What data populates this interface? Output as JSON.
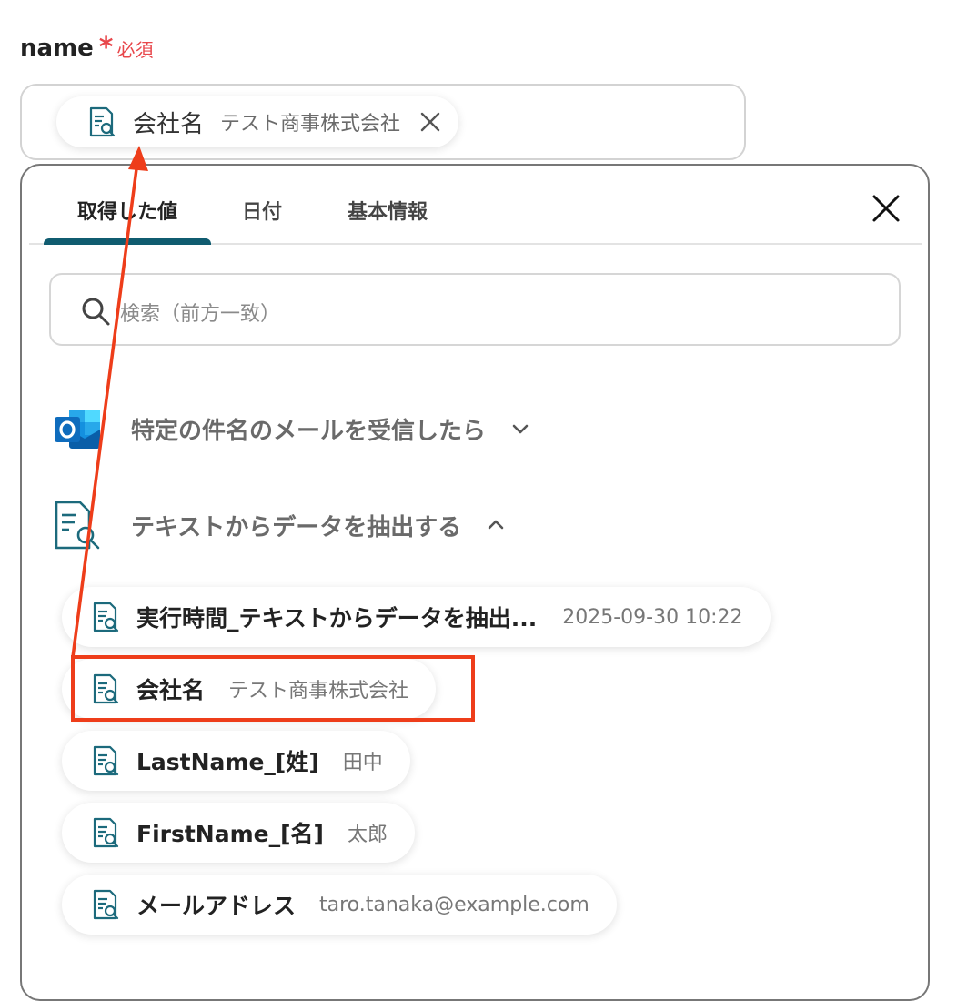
{
  "field": {
    "label": "name",
    "required_star": "*",
    "required_text": "必須",
    "required_color": "#e8474b"
  },
  "selected_value": {
    "icon": "document-search-icon",
    "name": "会社名",
    "value": "テスト商事株式会社",
    "remove_icon": "close-icon"
  },
  "panel": {
    "tabs": [
      {
        "label": "取得した値",
        "active": true
      },
      {
        "label": "日付",
        "active": false
      },
      {
        "label": "基本情報",
        "active": false
      }
    ],
    "close_icon": "close-icon",
    "search": {
      "placeholder": "検索（前方一致）",
      "icon": "search-icon"
    },
    "accent_color": "#105c70",
    "groups": [
      {
        "icon": "outlook-icon",
        "label": "特定の件名のメールを受信したら",
        "expanded": false,
        "toggle_icon": "chevron-down-icon"
      },
      {
        "icon": "document-search-icon",
        "label": "テキストからデータを抽出する",
        "expanded": true,
        "toggle_icon": "chevron-up-icon"
      }
    ],
    "items": [
      {
        "name": "実行時間_テキストからデータを抽出...",
        "value": "2025-09-30 10:22"
      },
      {
        "name": "会社名",
        "value": "テスト商事株式会社",
        "highlighted": true
      },
      {
        "name": "LastName_[姓]",
        "value": "田中"
      },
      {
        "name": "FirstName_[名]",
        "value": "太郎"
      },
      {
        "name": "メールアドレス",
        "value": "taro.tanaka@example.com"
      }
    ]
  },
  "annotation": {
    "highlight_color": "#ee3d1a",
    "arrow_color": "#ee3d1a"
  }
}
